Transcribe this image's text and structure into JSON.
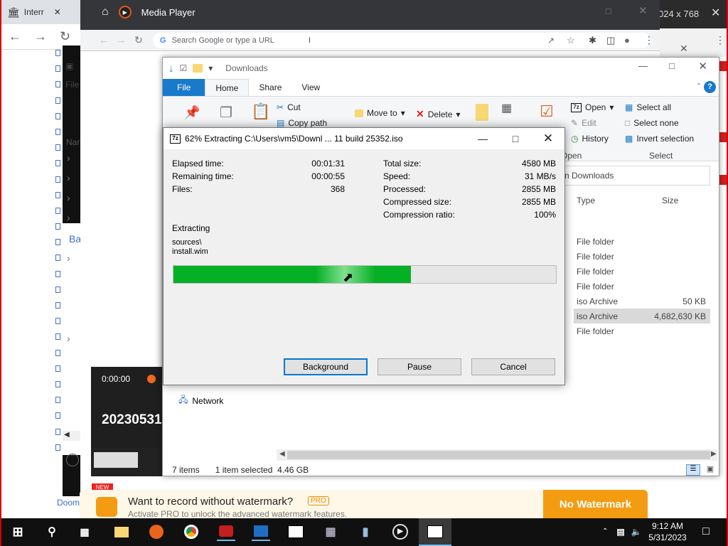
{
  "bg_browser": {
    "tab_title": "Interr",
    "side_labels": [
      "File",
      "Pro",
      "Nar",
      "Ba"
    ],
    "bottom_links": [
      "Doom",
      "Doom"
    ]
  },
  "right_window": {
    "resolution_text": "024 x 768"
  },
  "media_player": {
    "title": "Media Player"
  },
  "chrome": {
    "omnibox_placeholder": "Search Google or type a URL"
  },
  "explorer": {
    "title": "Downloads",
    "tabs": [
      "File",
      "Home",
      "Share",
      "View"
    ],
    "ribbon": {
      "cut": "Cut",
      "copy_path": "Copy path",
      "move_to": "Move to",
      "delete": "Delete",
      "open": "Open",
      "edit": "Edit",
      "history": "History",
      "open_group": "Open",
      "select_all": "Select all",
      "select_none": "Select none",
      "invert_selection": "Invert selection",
      "select_group": "Select"
    },
    "address_text": "n Downloads",
    "columns": {
      "type": "Type",
      "size": "Size"
    },
    "rows": [
      {
        "type": "File folder",
        "size": ""
      },
      {
        "type": "File folder",
        "size": ""
      },
      {
        "type": "File folder",
        "size": ""
      },
      {
        "type": "File folder",
        "size": ""
      },
      {
        "type": "iso Archive",
        "size": "50 KB"
      },
      {
        "type": "iso Archive",
        "size": "4,682,630 KB",
        "selected": true
      },
      {
        "type": "File folder",
        "size": ""
      }
    ],
    "nav_network": "Network",
    "status": {
      "items": "7 items",
      "selected": "1 item selected",
      "size": "4.46 GB"
    }
  },
  "zdialog": {
    "title": "62% Extracting C:\\Users\\vm5\\Downl ... 11 build 25352.iso",
    "progress_fraction": 0.62,
    "left_stats": [
      {
        "label": "Elapsed time:",
        "value": "00:01:31"
      },
      {
        "label": "Remaining time:",
        "value": "00:00:55"
      },
      {
        "label": "Files:",
        "value": "368"
      }
    ],
    "right_stats": [
      {
        "label": "Total size:",
        "value": "4580 MB"
      },
      {
        "label": "Speed:",
        "value": "31 MB/s"
      },
      {
        "label": "Processed:",
        "value": "2855 MB"
      },
      {
        "label": "Compressed size:",
        "value": "2855 MB"
      },
      {
        "label": "Compression ratio:",
        "value": "100%"
      }
    ],
    "extracting_label": "Extracting",
    "current_path_1": "sources\\",
    "current_path_2": "install.wim",
    "buttons": {
      "background": "Background",
      "pause": "Pause",
      "cancel": "Cancel"
    }
  },
  "recorder": {
    "time": "0:00:00",
    "filename": "20230531",
    "new_badge": "NEW"
  },
  "banner": {
    "headline": "Want to record without watermark?",
    "pro_badge": "PRO",
    "sub": "Activate PRO to unlock the advanced watermark features.",
    "button": "No Watermark"
  },
  "taskbar": {
    "time": "9:12 AM",
    "date": "5/31/2023",
    "z7_label": "7z"
  },
  "colors": {
    "progress_green": "#06b025",
    "explorer_file_tab": "#1979ca",
    "banner_orange": "#f39c12",
    "taskbar": "#101010"
  }
}
